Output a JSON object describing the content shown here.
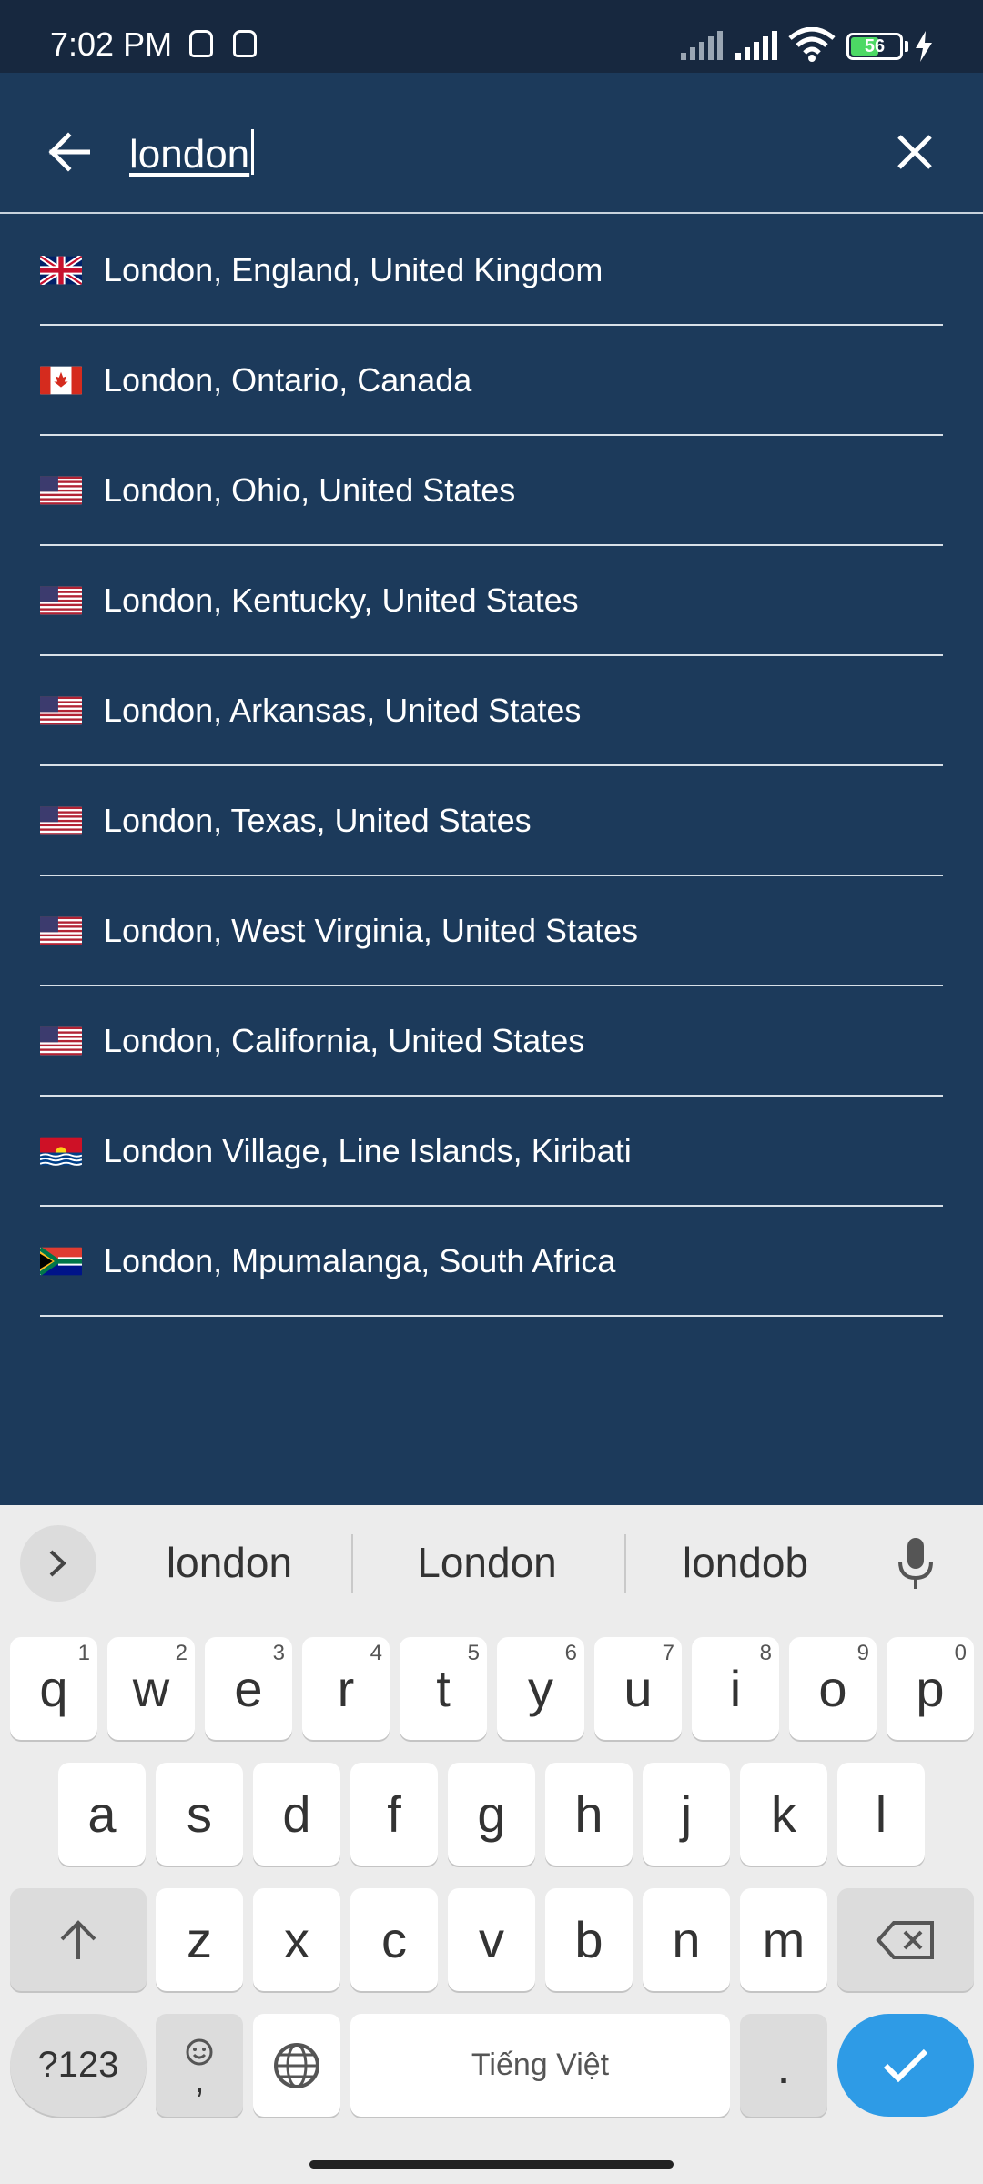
{
  "status": {
    "time": "7:02 PM",
    "battery": "56"
  },
  "search": {
    "query": "london"
  },
  "results": [
    {
      "label": "London, England, United Kingdom",
      "flag": "gb-flag-icon"
    },
    {
      "label": "London, Ontario, Canada",
      "flag": "ca-flag-icon"
    },
    {
      "label": "London, Ohio, United States",
      "flag": "us-flag-icon"
    },
    {
      "label": "London, Kentucky, United States",
      "flag": "us-flag-icon"
    },
    {
      "label": "London, Arkansas, United States",
      "flag": "us-flag-icon"
    },
    {
      "label": "London, Texas, United States",
      "flag": "us-flag-icon"
    },
    {
      "label": "London, West Virginia, United States",
      "flag": "us-flag-icon"
    },
    {
      "label": "London, California, United States",
      "flag": "us-flag-icon"
    },
    {
      "label": "London Village, Line Islands, Kiribati",
      "flag": "ki-flag-icon"
    },
    {
      "label": "London, Mpumalanga, South Africa",
      "flag": "za-flag-icon"
    }
  ],
  "keyboard": {
    "suggestions": [
      "london",
      "London",
      "londob"
    ],
    "row1": [
      {
        "k": "q",
        "h": "1"
      },
      {
        "k": "w",
        "h": "2"
      },
      {
        "k": "e",
        "h": "3"
      },
      {
        "k": "r",
        "h": "4"
      },
      {
        "k": "t",
        "h": "5"
      },
      {
        "k": "y",
        "h": "6"
      },
      {
        "k": "u",
        "h": "7"
      },
      {
        "k": "i",
        "h": "8"
      },
      {
        "k": "o",
        "h": "9"
      },
      {
        "k": "p",
        "h": "0"
      }
    ],
    "row2": [
      "a",
      "s",
      "d",
      "f",
      "g",
      "h",
      "j",
      "k",
      "l"
    ],
    "row3": [
      "z",
      "x",
      "c",
      "v",
      "b",
      "n",
      "m"
    ],
    "symbols_label": "?123",
    "comma": ",",
    "space_label": "Tiếng Việt",
    "period": "."
  },
  "colors": {
    "background": "#1c3a5b",
    "statusbar": "#17283f",
    "enter": "#2e9be6"
  }
}
